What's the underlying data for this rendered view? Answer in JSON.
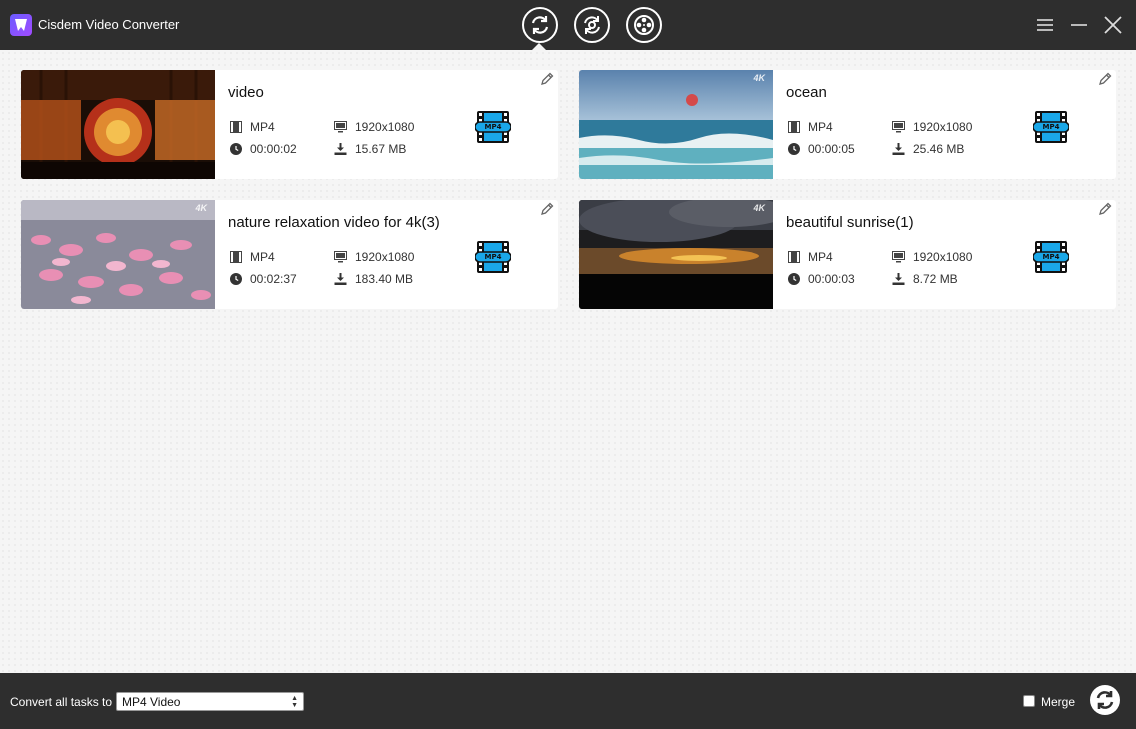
{
  "app": {
    "title": "Cisdem Video Converter"
  },
  "toolbar": {
    "modes": [
      {
        "name": "convert",
        "icon": "convert-icon",
        "active": true
      },
      {
        "name": "rip",
        "icon": "rip-icon",
        "active": false
      },
      {
        "name": "download",
        "icon": "film-reel-icon",
        "active": false
      }
    ]
  },
  "window_controls": [
    "menu-icon",
    "minimize-icon",
    "close-icon"
  ],
  "videos": [
    {
      "title": "video",
      "format": "MP4",
      "resolution": "1920x1080",
      "duration": "00:00:02",
      "size": "15.67 MB",
      "output_format": "MP4",
      "thumb": "stained-glass",
      "badge": ""
    },
    {
      "title": "ocean",
      "format": "MP4",
      "resolution": "1920x1080",
      "duration": "00:00:05",
      "size": "25.46 MB",
      "output_format": "MP4",
      "thumb": "ocean",
      "badge": "4K"
    },
    {
      "title": "nature relaxation video for 4k(3)",
      "format": "MP4",
      "resolution": "1920x1080",
      "duration": "00:02:37",
      "size": "183.40 MB",
      "output_format": "MP4",
      "thumb": "flamingos",
      "badge": "4K"
    },
    {
      "title": "beautiful sunrise(1)",
      "format": "MP4",
      "resolution": "1920x1080",
      "duration": "00:00:03",
      "size": "8.72 MB",
      "output_format": "MP4",
      "thumb": "sunrise",
      "badge": "4K"
    }
  ],
  "bottom": {
    "convert_label": "Convert all tasks to",
    "selected_format": "MP4 Video",
    "merge_label": "Merge",
    "merge_checked": false
  },
  "colors": {
    "titlebar": "#2e2e2e",
    "accent": "#1aa7e8",
    "logo": "#7b4dff"
  }
}
